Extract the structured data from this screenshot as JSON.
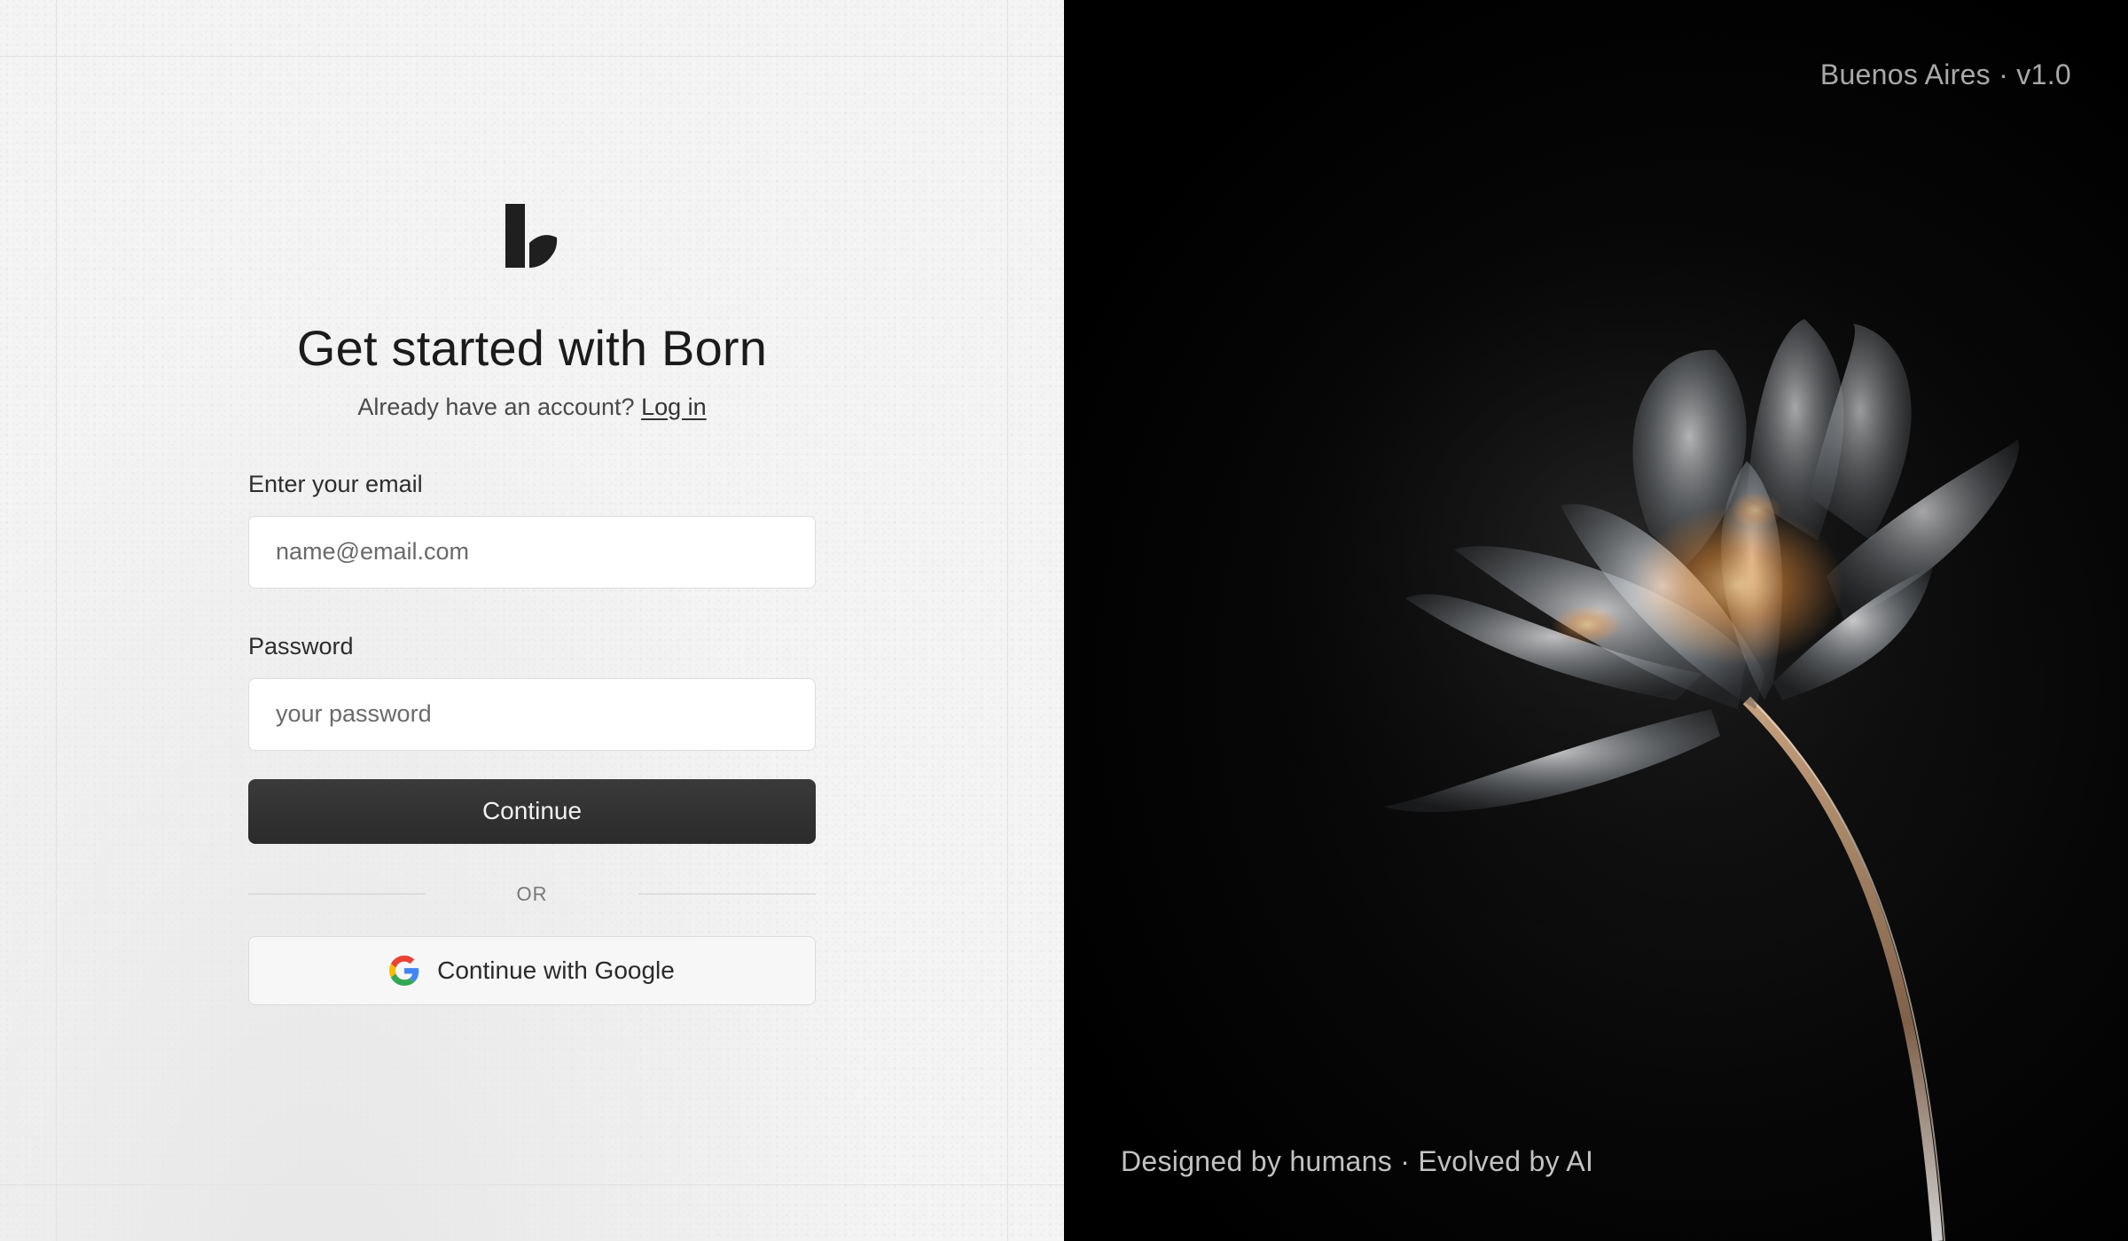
{
  "brand": {
    "logo_icon": "born-logo-icon"
  },
  "signup": {
    "title": "Get started with Born",
    "subtitle_prefix": "Already have an account?",
    "login_link": "Log in",
    "email_label": "Enter your email",
    "email_placeholder": "name@email.com",
    "password_label": "Password",
    "password_placeholder": "your password",
    "continue_label": "Continue",
    "divider_label": "OR",
    "google_label": "Continue with Google",
    "google_icon": "google-icon"
  },
  "showcase": {
    "version": "Buenos Aires · v1.0",
    "tagline": "Designed by humans · Evolved by AI",
    "image": "glass-flower-image"
  },
  "colors": {
    "primary_button": "#2f2f2f",
    "left_background": "#f4f4f4",
    "right_background": "#000000"
  }
}
